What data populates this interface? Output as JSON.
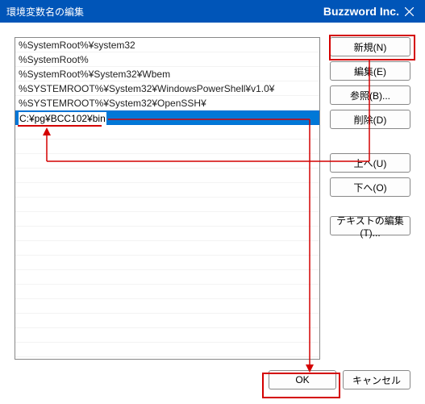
{
  "title": "環境変数名の編集",
  "brand": "Buzzword Inc.",
  "paths": [
    "%SystemRoot%¥system32",
    "%SystemRoot%",
    "%SystemRoot%¥System32¥Wbem",
    "%SYSTEMROOT%¥System32¥WindowsPowerShell¥v1.0¥",
    "%SYSTEMROOT%¥System32¥OpenSSH¥"
  ],
  "editing_value": "C:¥pg¥BCC102¥bin",
  "buttons": {
    "new": "新規(N)",
    "edit": "編集(E)",
    "browse": "参照(B)...",
    "delete": "削除(D)",
    "up": "上へ(U)",
    "down": "下へ(O)",
    "edit_text": "テキストの編集(T)...",
    "ok": "OK",
    "cancel": "キャンセル"
  }
}
